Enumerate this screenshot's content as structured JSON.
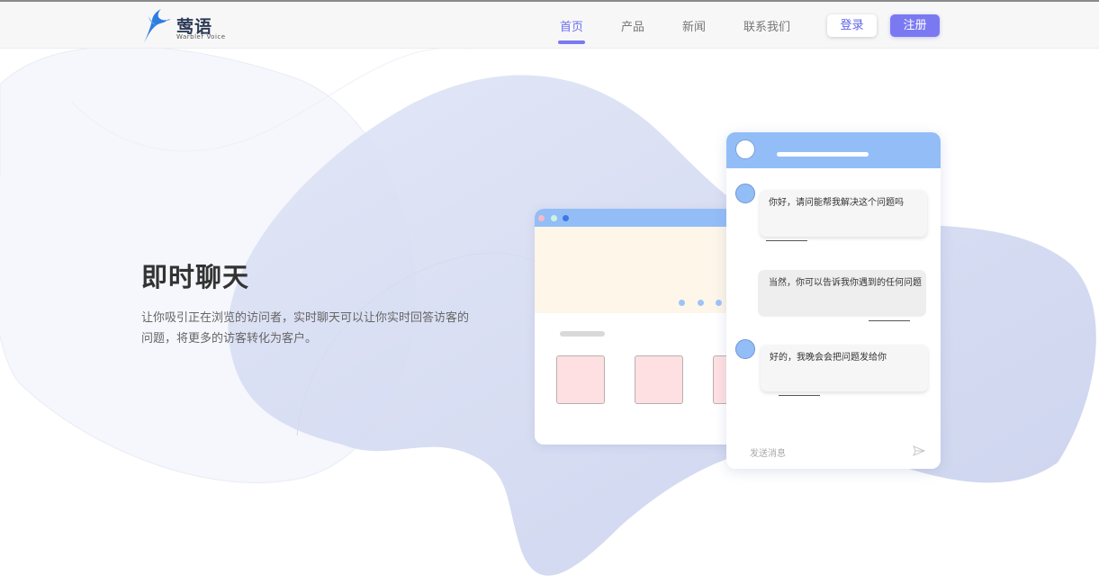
{
  "brand": {
    "name": "莺语",
    "subtitle": "Warbler Voice"
  },
  "nav": {
    "items": [
      {
        "label": "首页",
        "active": true
      },
      {
        "label": "产品",
        "active": false
      },
      {
        "label": "新闻",
        "active": false
      },
      {
        "label": "联系我们",
        "active": false
      }
    ],
    "login_label": "登录",
    "register_label": "注册"
  },
  "hero": {
    "title": "即时聊天",
    "description": "让你吸引正在浏览的访问者，实时聊天可以让你实时回答访客的问题，将更多的访客转化为客户。"
  },
  "chat": {
    "messages": [
      {
        "from": "visitor",
        "text": "你好，请问能帮我解决这个问题吗"
      },
      {
        "from": "agent",
        "text": "当然，你可以告诉我你遇到的任何问题"
      },
      {
        "from": "visitor",
        "text": "好的，我晚会会把问题发给你"
      }
    ],
    "input_placeholder": "发送消息",
    "send_icon": "send-icon"
  },
  "colors": {
    "accent": "#7b79f2",
    "nav_active": "#6d6ff0",
    "illustration_blue": "#93bdf7",
    "blob": "#c9d2ee",
    "banner": "#fdf6e9",
    "card": "#ffe0e2"
  }
}
